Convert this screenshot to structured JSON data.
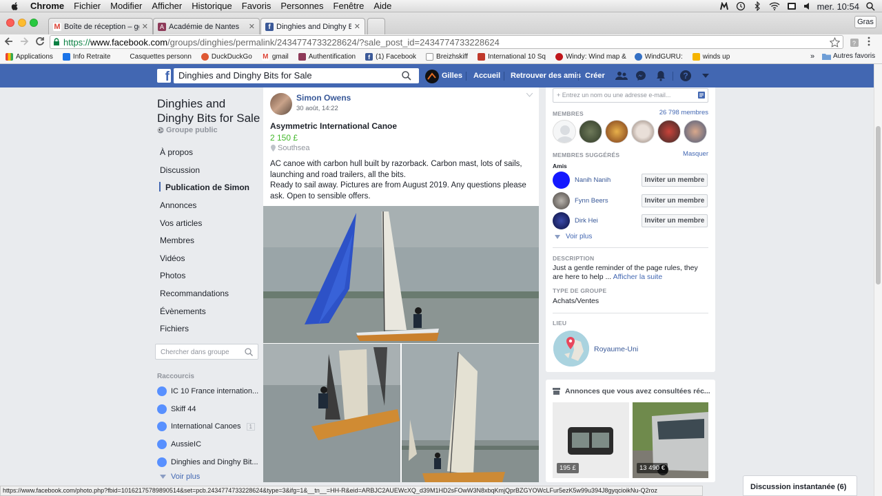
{
  "mac_menu": {
    "app": "Chrome",
    "items": [
      "Fichier",
      "Modifier",
      "Afficher",
      "Historique",
      "Favoris",
      "Personnes",
      "Fenêtre",
      "Aide"
    ],
    "clock": "mer. 10:54"
  },
  "tabs": [
    {
      "title": "Boîte de réception – ggras",
      "favicon_color": "#db4437",
      "favicon_glyph": "M"
    },
    {
      "title": "Académie de Nantes",
      "favicon_color": "#8e3a59",
      "favicon_glyph": "A"
    },
    {
      "title": "Dinghies and Dinghy Bits f",
      "favicon_color": "#3b5998",
      "favicon_glyph": "f"
    }
  ],
  "browser": {
    "profile_label": "Gras",
    "url_scheme": "https://",
    "url_host": "www.facebook.com",
    "url_path": "/groups/dinghies/permalink/2434774733228624/?sale_post_id=2434774733228624"
  },
  "bookmarks": [
    {
      "label": "Applications",
      "icon": "grid-icon",
      "color": "#e94235"
    },
    {
      "label": "Info Retraite",
      "icon": "info-icon",
      "color": "#1a73e8"
    },
    {
      "label": "Casquettes personn",
      "icon": "cap-icon",
      "color": "#888888"
    },
    {
      "label": "DuckDuckGo",
      "icon": "duck-icon",
      "color": "#de5833"
    },
    {
      "label": "gmail",
      "icon": "gmail-icon",
      "color": "#db4437"
    },
    {
      "label": "Authentification",
      "icon": "key-icon",
      "color": "#8e3a59"
    },
    {
      "label": "(1) Facebook",
      "icon": "facebook-icon",
      "color": "#3b5998"
    },
    {
      "label": "Breizhskiff",
      "icon": "page-icon",
      "color": "#999999"
    },
    {
      "label": "International 10 Sq",
      "icon": "page-icon",
      "color": "#c0392b"
    },
    {
      "label": "Windy: Wind map &",
      "icon": "windy-icon",
      "color": "#c0161b"
    },
    {
      "label": "WindGURU:",
      "icon": "windguru-icon",
      "color": "#3470c4"
    },
    {
      "label": "winds up",
      "icon": "wind-icon",
      "color": "#f5b400"
    }
  ],
  "bookmarks_other": "Autres favoris",
  "fb": {
    "search_value": "Dinghies and Dinghy Bits for Sale",
    "user": "Gilles",
    "nav": [
      "Accueil",
      "Retrouver des amis",
      "Créer"
    ]
  },
  "group": {
    "name": "Dinghies and Dinghy Bits for Sale",
    "privacy": "Groupe public",
    "nav": [
      "À propos",
      "Discussion",
      "Publication de Simon",
      "Annonces",
      "Vos articles",
      "Membres",
      "Vidéos",
      "Photos",
      "Recommandations",
      "Évènements",
      "Fichiers"
    ],
    "search_placeholder": "Chercher dans groupe",
    "shortcuts_title": "Raccourcis",
    "shortcuts": [
      {
        "label": "IC 10 France internation...",
        "badge": ""
      },
      {
        "label": "Skiff 44",
        "badge": ""
      },
      {
        "label": "International Canoes",
        "badge": "1"
      },
      {
        "label": "AussieIC",
        "badge": ""
      },
      {
        "label": "Dinghies and Dinghy Bit...",
        "badge": ""
      }
    ],
    "see_more": "Voir plus"
  },
  "post": {
    "author": "Simon Owens",
    "date": "30 août, 14:22",
    "title": "Asymmetric International Canoe",
    "price": "2 150 £",
    "location": "Southsea",
    "body_1": "AC canoe with carbon hull built by razorback. Carbon mast, lots of sails, launching and road trailers, all the bits.",
    "body_2": "Ready to sail away. Pictures are from August 2019. Any questions please ask. Open to sensible offers."
  },
  "sidebar": {
    "invite_placeholder": "+ Entrez un nom ou une adresse e-mail...",
    "members_label": "MEMBRES",
    "members_count": "26 798 membres",
    "suggested_label": "MEMBRES SUGGÉRÉS",
    "hide": "Masquer",
    "friends_label": "Amis",
    "suggested": [
      {
        "name": "Nanih Nanih",
        "button": "Inviter un membre"
      },
      {
        "name": "Fynn Beers",
        "button": "Inviter un membre"
      },
      {
        "name": "Dirk Hei",
        "button": "Inviter un membre"
      }
    ],
    "see_more": "Voir plus",
    "description_label": "DESCRIPTION",
    "description": "Just a gentle reminder of the page rules, they are here to help ...",
    "description_more": "Afficher la suite",
    "group_type_label": "TYPE DE GROUPE",
    "group_type": "Achats/Ventes",
    "location_label": "LIEU",
    "location": "Royaume-Uni"
  },
  "recent": {
    "title": "Annonces que vous avez consultées réc...",
    "items": [
      {
        "price": "195 £"
      },
      {
        "price": "13 490 €"
      }
    ]
  },
  "status_url": "https://www.facebook.com/photo.php?fbid=10162175789890514&set=pcb.2434774733228624&type=3&ifg=1&__tn__=HH-R&eid=ARBJC2AUEWcXQ_d39M1HD2sFOwW3N8xbqKmjQprBZGYOWcLFur5ezK5w99u394J8gyqcioikNu-Q2roz",
  "chat_label": "Discussion instantanée (6)"
}
